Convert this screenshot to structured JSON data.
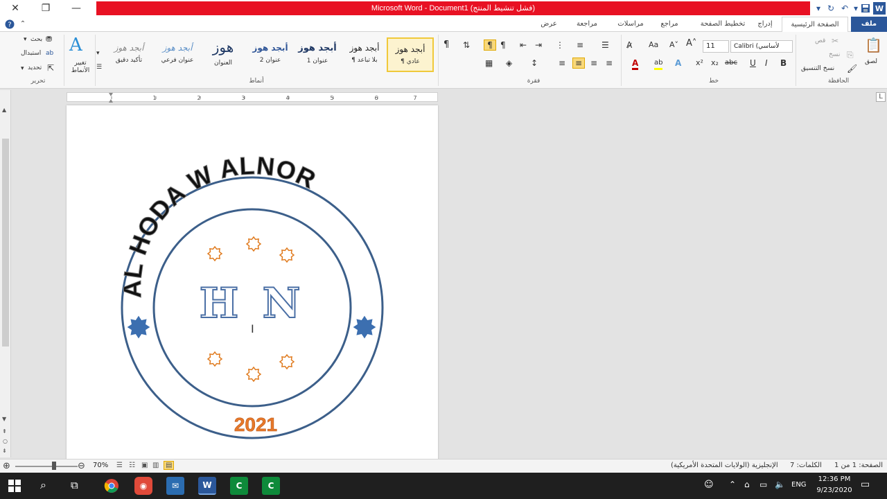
{
  "titlebar": {
    "title": "Microsoft Word - Document1 (فشل تنشيط المنتج)",
    "close_glyph": "✕",
    "restore_glyph": "❐",
    "minimize_glyph": "—"
  },
  "tabs": {
    "file": "ملف",
    "home": "الصفحة الرئيسية",
    "insert": "إدراج",
    "layout": "تخطيط الصفحة",
    "references": "مراجع",
    "mailings": "مراسلات",
    "review": "مراجعة",
    "view": "عرض"
  },
  "clipboard": {
    "paste": "لصق",
    "cut": "قص",
    "copy": "نسخ",
    "format_painter": "نسخ التنسيق",
    "label": "الحافظة"
  },
  "font": {
    "name": "Calibri (لأساسي",
    "size": "11",
    "label": "خط"
  },
  "paragraph": {
    "label": "فقرة"
  },
  "styles": {
    "label": "أنماط",
    "change_styles": "تغيير الأنماط",
    "items": [
      {
        "preview": "أبجد هوز",
        "name": "¶ عادي"
      },
      {
        "preview": "أبجد هوز",
        "name": "¶ بلا تباعد"
      },
      {
        "preview": "أبجد هوز",
        "name": "عنوان 1"
      },
      {
        "preview": "أبجد هوز",
        "name": "عنوان 2"
      },
      {
        "preview": "هوز",
        "name": "العنوان"
      },
      {
        "preview": "أبجد هوز",
        "name": "عنوان فرعي"
      },
      {
        "preview": "أبجد هوز",
        "name": "تأكيد دقيق"
      }
    ]
  },
  "editing": {
    "find": "بحث",
    "replace": "استبدال",
    "select": "تحديد",
    "label": "تحرير"
  },
  "logo": {
    "arc_text": "AL HODA W ALNOR",
    "left_letter": "H",
    "right_letter": "N",
    "year": "2021",
    "ring_color": "#3c5f8a",
    "star_color": "#e07b1f",
    "side_star_color": "#3c6fb0"
  },
  "status": {
    "page": "الصفحة: 1 من 1",
    "words": "الكلمات: 7",
    "language": "الإنجليزية (الولايات المتحدة الأمريكية)",
    "zoom": "70%"
  },
  "taskbar": {
    "time": "12:36 PM",
    "date": "9/23/2020",
    "lang": "ENG"
  }
}
